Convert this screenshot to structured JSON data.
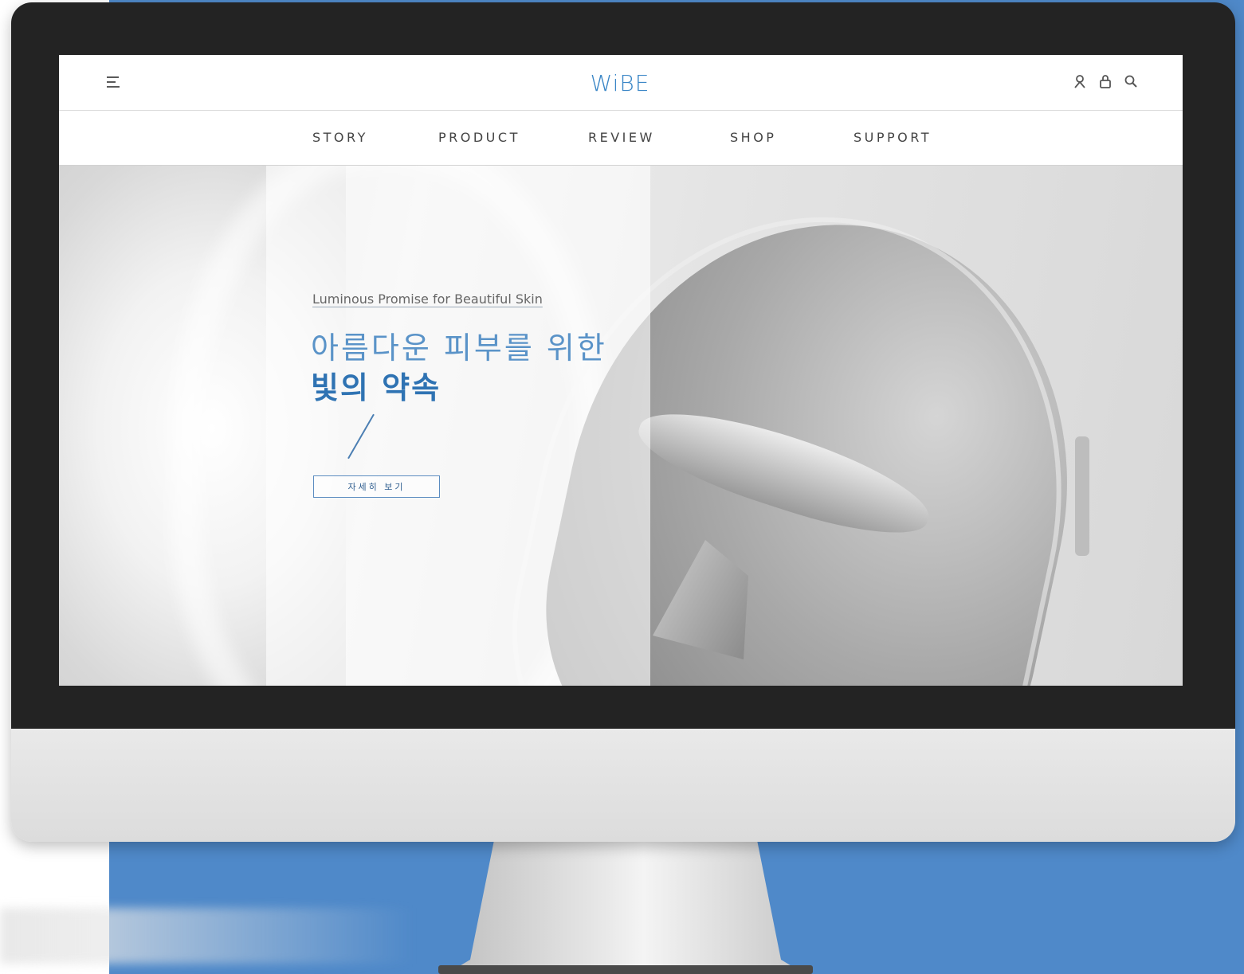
{
  "brand": {
    "name": "WiBE",
    "color": "#3a86c6"
  },
  "header": {
    "icons": [
      "menu-icon",
      "user-icon",
      "bag-icon",
      "search-icon"
    ]
  },
  "nav": {
    "items": [
      {
        "label": "STORY"
      },
      {
        "label": "PRODUCT"
      },
      {
        "label": "REVIEW"
      },
      {
        "label": "SHOP"
      },
      {
        "label": "SUPPORT"
      }
    ]
  },
  "hero": {
    "tagline": "Luminous Promise for Beautiful Skin",
    "headline_line1": "아름다운 피부를 위한",
    "headline_line2": "빛의 약속",
    "cta_label": "자세히 보기",
    "accent_color": "#2f73b3"
  },
  "device": {
    "frame_color": "#232323",
    "background_color": "#4f89c9"
  }
}
